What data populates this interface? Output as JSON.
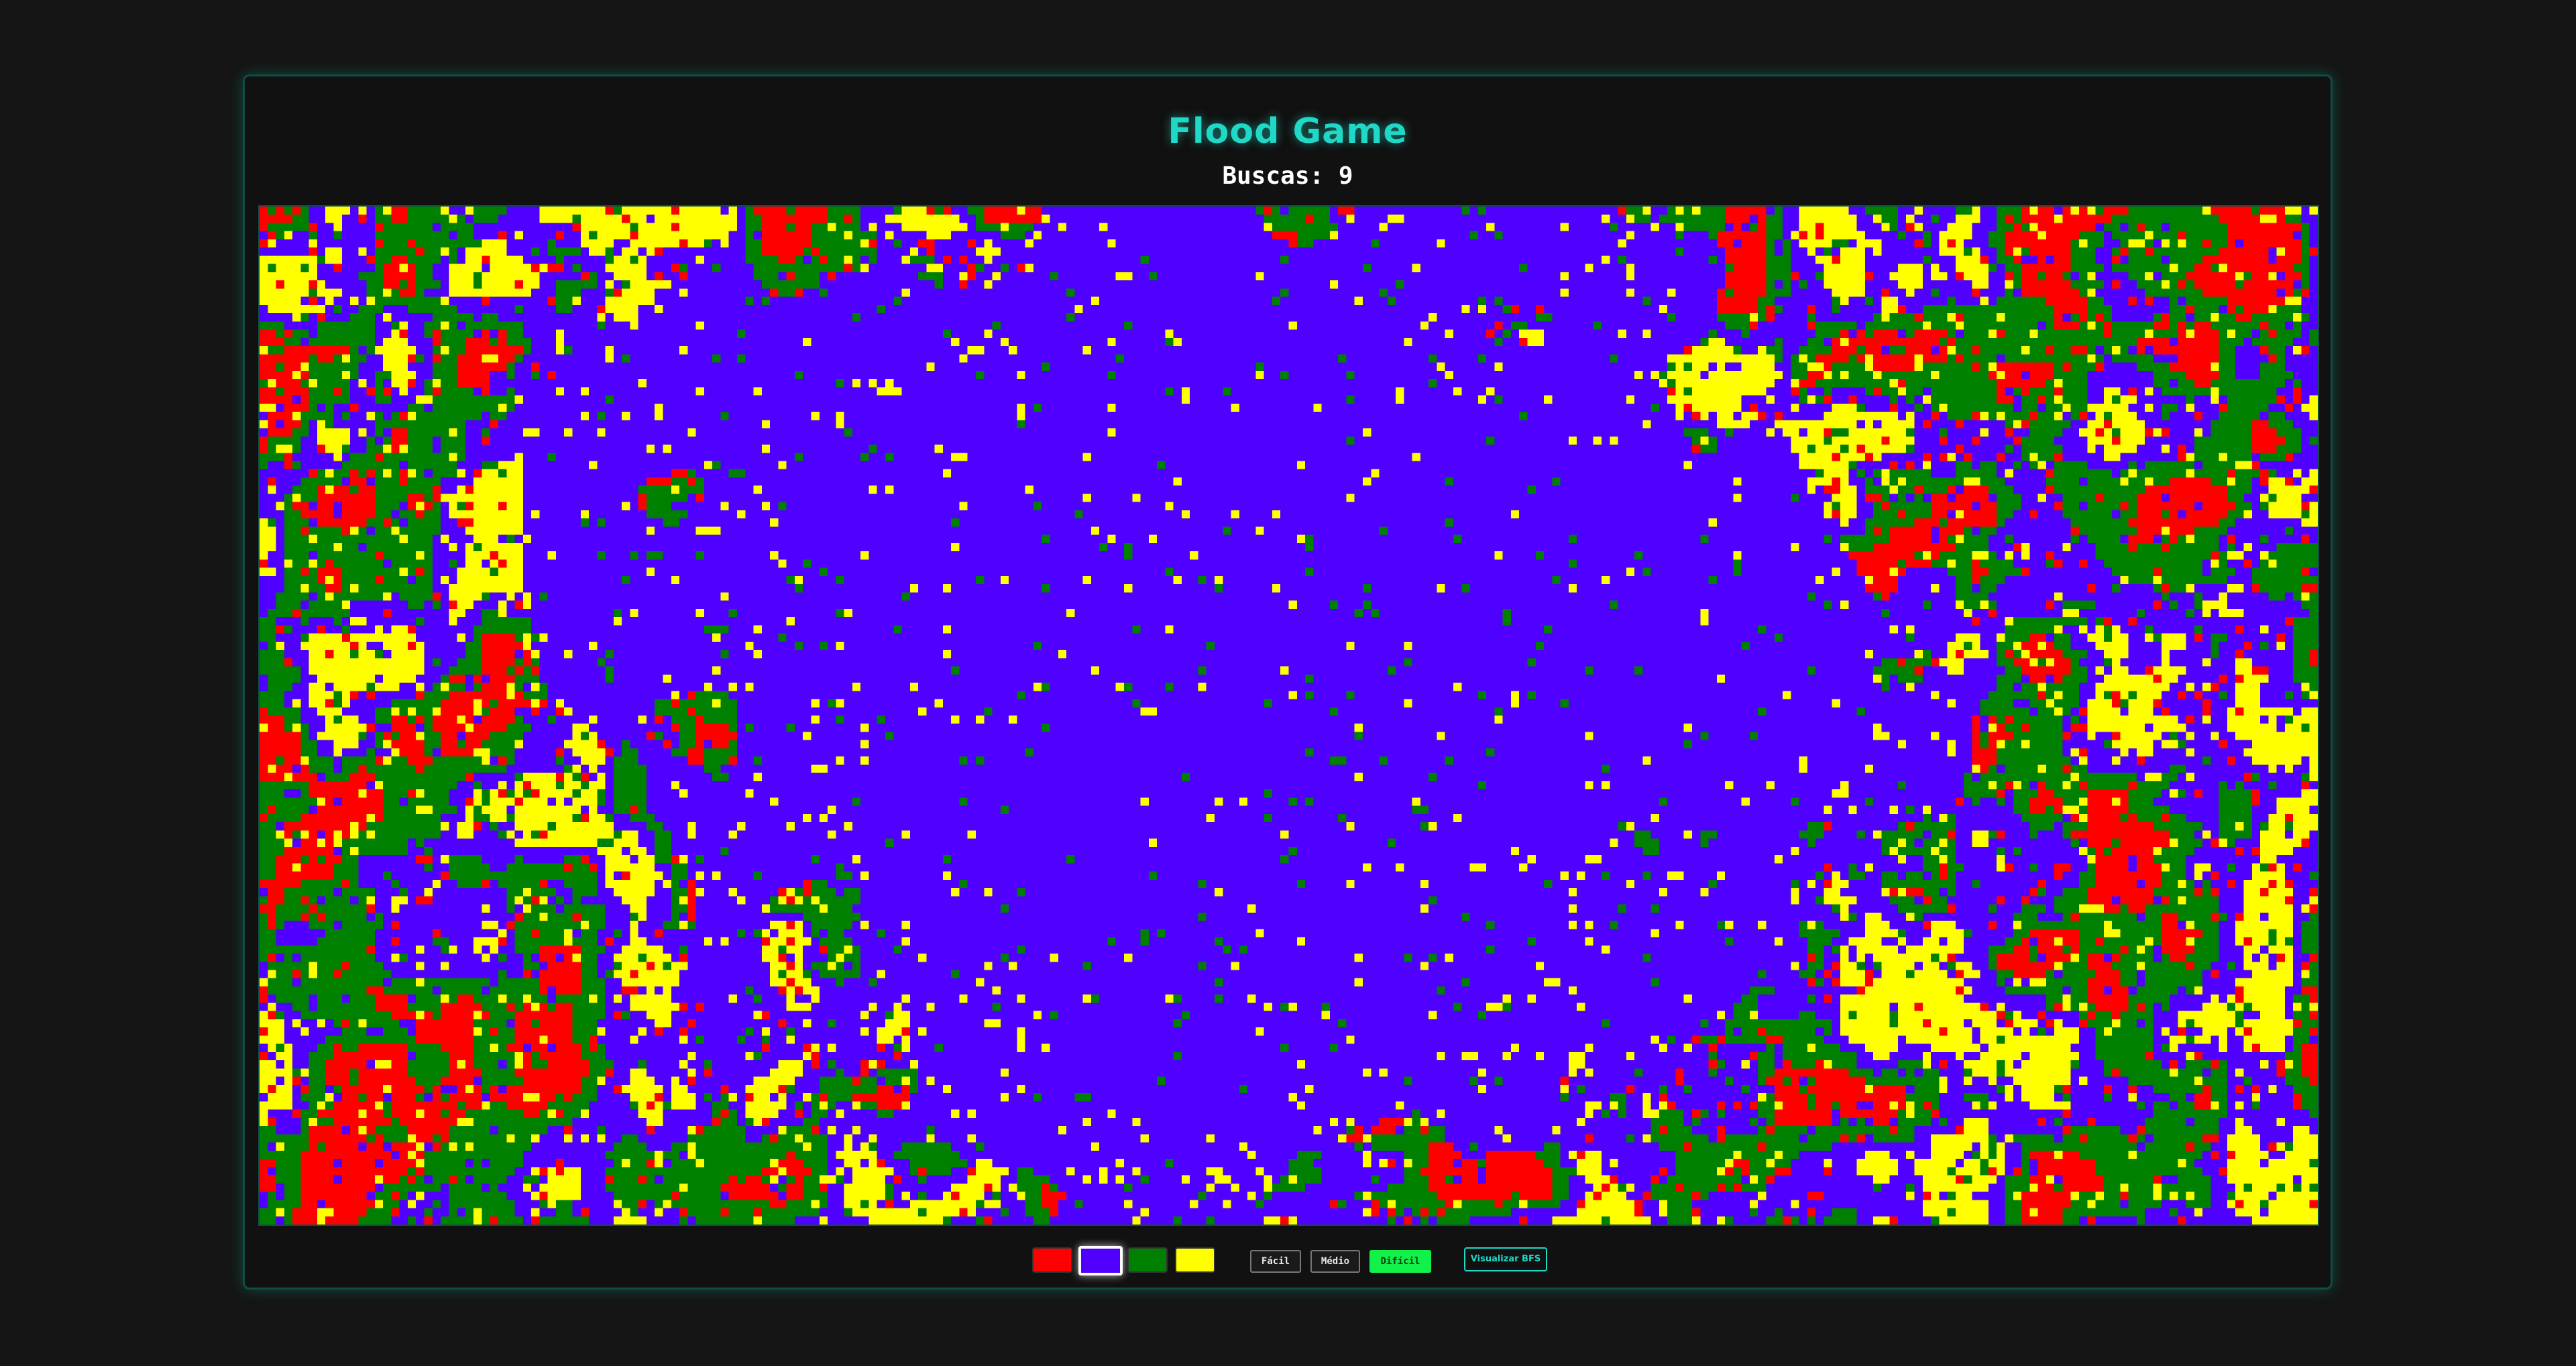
{
  "header": {
    "title": "Flood Game",
    "moves_label": "Buscas: 9"
  },
  "board": {
    "columns": 250,
    "rows": 124,
    "flooded_color": "#5000ff",
    "palette": [
      "#ff0000",
      "#5000ff",
      "#008000",
      "#ffff00"
    ]
  },
  "controls": {
    "colors": [
      {
        "name": "red",
        "hex": "#ff0000",
        "selected": false
      },
      {
        "name": "purple",
        "hex": "#5000ff",
        "selected": true
      },
      {
        "name": "green",
        "hex": "#008000",
        "selected": false
      },
      {
        "name": "yellow",
        "hex": "#ffff00",
        "selected": false
      }
    ],
    "difficulty": [
      {
        "label": "Fácil",
        "active": false
      },
      {
        "label": "Médio",
        "active": false
      },
      {
        "label": "Difícil",
        "active": true
      }
    ],
    "bfs_label": "Visualizar BFS"
  }
}
